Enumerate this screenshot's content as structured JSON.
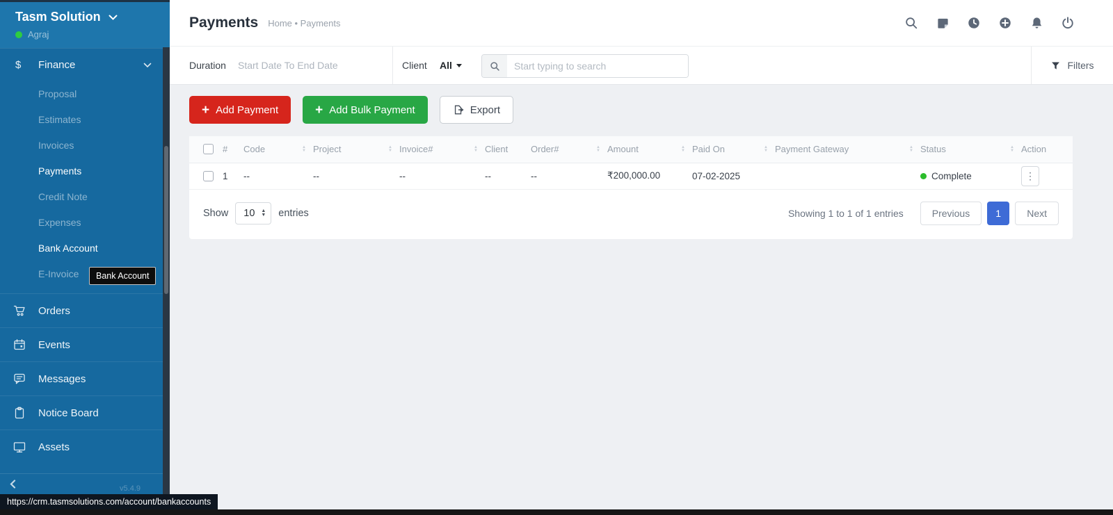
{
  "sidebar": {
    "company": "Tasm Solution",
    "user": "Agraj",
    "finance_label": "Finance",
    "finance_items": [
      {
        "label": "Proposal",
        "state": "muted"
      },
      {
        "label": "Estimates",
        "state": "muted"
      },
      {
        "label": "Invoices",
        "state": "muted"
      },
      {
        "label": "Payments",
        "state": "active"
      },
      {
        "label": "Credit Note",
        "state": "muted"
      },
      {
        "label": "Expenses",
        "state": "muted"
      },
      {
        "label": "Bank Account",
        "state": "hover"
      },
      {
        "label": "E-Invoice",
        "state": "muted"
      }
    ],
    "tooltip": "Bank Account",
    "menu_items": [
      {
        "label": "Orders",
        "icon": "cart-icon"
      },
      {
        "label": "Events",
        "icon": "calendar-icon"
      },
      {
        "label": "Messages",
        "icon": "chat-icon"
      },
      {
        "label": "Notice Board",
        "icon": "clipboard-icon"
      },
      {
        "label": "Assets",
        "icon": "monitor-icon"
      }
    ],
    "version": "v5.4.9"
  },
  "statusbar": {
    "url": "https://crm.tasmsolutions.com/account/bankaccounts"
  },
  "header": {
    "title": "Payments",
    "breadcrumb": "Home • Payments",
    "icons": [
      "search-icon",
      "note-icon",
      "clock-icon",
      "plus-circle-icon",
      "bell-icon",
      "power-icon"
    ]
  },
  "filterbar": {
    "duration_label": "Duration",
    "duration_placeholder": "Start Date To End Date",
    "client_label": "Client",
    "client_value": "All",
    "search_placeholder": "Start typing to search",
    "filters_label": "Filters"
  },
  "actions": {
    "add_payment": "Add Payment",
    "add_bulk_payment": "Add Bulk Payment",
    "export": "Export"
  },
  "table": {
    "columns": [
      {
        "key": "checkbox",
        "label": "",
        "sortable": false
      },
      {
        "key": "num",
        "label": "#",
        "sortable": false
      },
      {
        "key": "code",
        "label": "Code",
        "sortable": true
      },
      {
        "key": "project",
        "label": "Project",
        "sortable": true
      },
      {
        "key": "invoice",
        "label": "Invoice#",
        "sortable": true
      },
      {
        "key": "client",
        "label": "Client",
        "sortable": false
      },
      {
        "key": "order",
        "label": "Order#",
        "sortable": true
      },
      {
        "key": "amount",
        "label": "Amount",
        "sortable": true
      },
      {
        "key": "paid_on",
        "label": "Paid On",
        "sortable": true
      },
      {
        "key": "gateway",
        "label": "Payment Gateway",
        "sortable": true
      },
      {
        "key": "status",
        "label": "Status",
        "sortable": true
      },
      {
        "key": "action",
        "label": "Action",
        "sortable": false
      }
    ],
    "rows": [
      {
        "num": "1",
        "code": "--",
        "project": "--",
        "invoice": "--",
        "client": "--",
        "order": "--",
        "amount": "₹200,000.00",
        "paid_on": "07-02-2025",
        "gateway": "",
        "status": "Complete"
      }
    ]
  },
  "pagination": {
    "show_label": "Show",
    "page_size": "10",
    "entries_label": "entries",
    "summary": "Showing 1 to 1 of 1 entries",
    "previous_label": "Previous",
    "current_page": "1",
    "next_label": "Next"
  },
  "colors": {
    "sidebar_blue": "#16699f",
    "sidebar_header_blue": "#1e76ac",
    "danger_red": "#d6251c",
    "success_green": "#28a745",
    "pagination_blue": "#3e6bd6",
    "status_green": "#2cbd2c"
  }
}
